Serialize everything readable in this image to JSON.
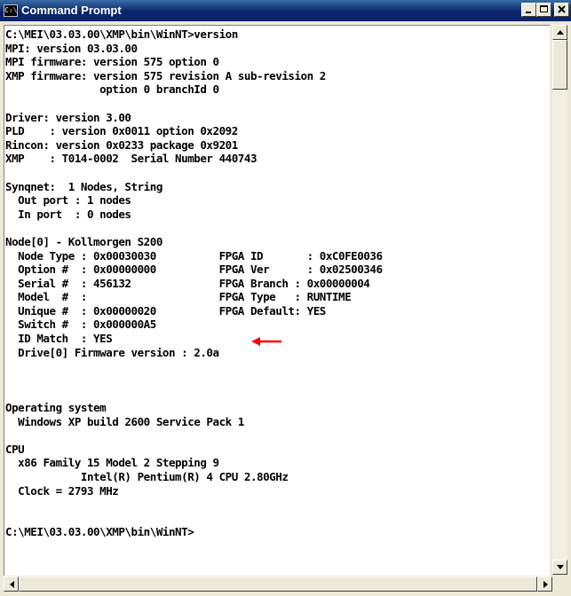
{
  "window": {
    "title": "Command Prompt",
    "icon_text": "C:\\"
  },
  "console_lines": [
    "C:\\MEI\\03.03.00\\XMP\\bin\\WinNT>version",
    "MPI: version 03.03.00",
    "MPI firmware: version 575 option 0",
    "XMP firmware: version 575 revision A sub-revision 2",
    "               option 0 branchId 0",
    "",
    "Driver: version 3.00",
    "PLD    : version 0x0011 option 0x2092",
    "Rincon: version 0x0233 package 0x9201",
    "XMP    : T014-0002  Serial Number 440743",
    "",
    "Synqnet:  1 Nodes, String",
    "  Out port : 1 nodes",
    "  In port  : 0 nodes",
    "",
    "Node[0] - Kollmorgen S200",
    "  Node Type : 0x00030030          FPGA ID       : 0xC0FE0036",
    "  Option #  : 0x00000000          FPGA Ver      : 0x02500346",
    "  Serial #  : 456132              FPGA Branch : 0x00000004",
    "  Model  #  :                     FPGA Type   : RUNTIME",
    "  Unique #  : 0x00000020          FPGA Default: YES",
    "  Switch #  : 0x000000A5",
    "  ID Match  : YES",
    "  Drive[0] Firmware version : 2.0a",
    "",
    "",
    "",
    "Operating system",
    "  Windows XP build 2600 Service Pack 1",
    "",
    "CPU",
    "  x86 Family 15 Model 2 Stepping 9",
    "            Intel(R) Pentium(R) 4 CPU 2.80GHz",
    "  Clock = 2793 MHz",
    "",
    "",
    "C:\\MEI\\03.03.00\\XMP\\bin\\WinNT>"
  ],
  "annotation": {
    "color": "#ff0000",
    "icon": "red-arrow-icon"
  },
  "colors": {
    "titlebar": "#0a246a",
    "console_bg": "#ffffff",
    "console_fg": "#000000"
  }
}
